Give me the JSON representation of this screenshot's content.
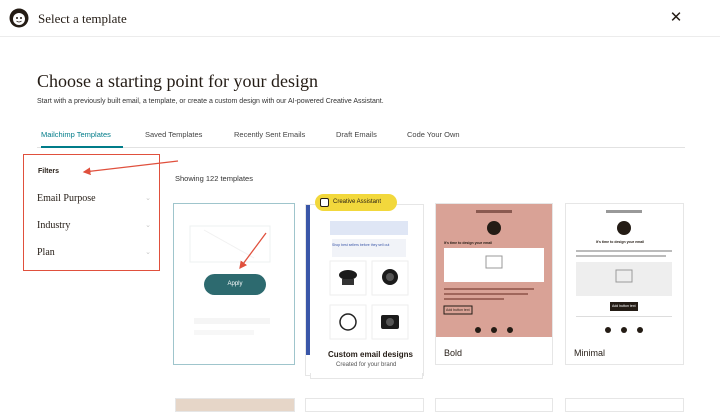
{
  "header": {
    "title": "Select a template",
    "close_icon": "close-icon"
  },
  "main": {
    "heading": "Choose a starting point for your design",
    "subheading": "Start with a previously built email, a template, or create a custom design with our AI-powered Creative Assistant.",
    "tabs": [
      {
        "label": "Mailchimp Templates",
        "active": true
      },
      {
        "label": "Saved Templates"
      },
      {
        "label": "Recently Sent Emails"
      },
      {
        "label": "Draft Emails"
      },
      {
        "label": "Code Your Own"
      }
    ],
    "showing": "Showing 122 templates"
  },
  "filters": {
    "title": "Filters",
    "items": [
      {
        "label": "Email Purpose"
      },
      {
        "label": "Industry"
      },
      {
        "label": "Plan"
      }
    ]
  },
  "cards": {
    "first": {
      "apply_label": "Apply"
    },
    "custom": {
      "badge": "Creative Assistant",
      "title": "Custom email designs",
      "caption": "Created for your brand",
      "preview_headline": "Shop best sellers before they sell out"
    },
    "bold": {
      "name": "Bold",
      "preview_headline": "It's time to design your email",
      "preview_button": "Add button text"
    },
    "minimal": {
      "name": "Minimal",
      "preview_headline": "It's time to design your email",
      "preview_button": "Add button text"
    }
  },
  "colors": {
    "accent": "#007c89",
    "annotation": "#e0503d",
    "apply_button": "#2d6a6f",
    "bold_bg": "#d9a296",
    "badge": "#f2d83c"
  }
}
